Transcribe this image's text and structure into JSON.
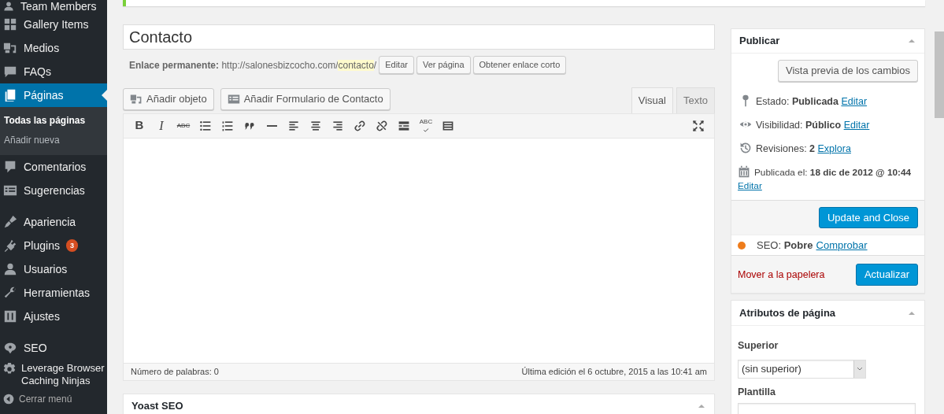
{
  "sidebar": {
    "groups": [
      [
        {
          "label": "Team Members",
          "selected": false
        },
        {
          "label": "Gallery Items",
          "selected": false
        },
        {
          "label": "Medios",
          "selected": false
        },
        {
          "label": "FAQs",
          "selected": false
        },
        {
          "label": "Páginas",
          "selected": true,
          "children": [
            {
              "label": "Todas las páginas",
              "selected": true
            },
            {
              "label": "Añadir nueva",
              "selected": false
            }
          ]
        },
        {
          "label": "Comentarios",
          "selected": false
        },
        {
          "label": "Sugerencias",
          "selected": false
        }
      ],
      [
        {
          "label": "Apariencia",
          "selected": false
        },
        {
          "label": "Plugins",
          "selected": false,
          "badge": "3"
        },
        {
          "label": "Usuarios",
          "selected": false
        },
        {
          "label": "Herramientas",
          "selected": false
        },
        {
          "label": "Ajustes",
          "selected": false
        }
      ],
      [
        {
          "label": "SEO",
          "selected": false
        },
        {
          "label": "Leverage Browser Caching Ninjas",
          "selected": false
        }
      ]
    ],
    "collapse": "Cerrar menú"
  },
  "editor": {
    "title": "Contacto",
    "permalink": {
      "label": "Enlace permanente:",
      "prefix": "http://salonesbizcocho.com/",
      "slug": "contacto",
      "suffix": "/",
      "buttons": [
        "Editar",
        "Ver página",
        "Obtener enlace corto"
      ]
    },
    "media_buttons": [
      "Añadir objeto",
      "Añadir Formulario de Contacto"
    ],
    "tabs": [
      {
        "label": "Visual",
        "selected": true
      },
      {
        "label": "Texto",
        "selected": false
      }
    ],
    "toolbar": [
      {
        "kind": "bold",
        "label": "B"
      },
      {
        "kind": "italic",
        "label": "I"
      },
      {
        "kind": "strike",
        "label": "ABC"
      },
      {
        "kind": "ul"
      },
      {
        "kind": "ol"
      },
      {
        "kind": "quote"
      },
      {
        "kind": "hr"
      },
      {
        "kind": "alignleft"
      },
      {
        "kind": "aligncenter"
      },
      {
        "kind": "alignright"
      },
      {
        "kind": "link"
      },
      {
        "kind": "unlink"
      },
      {
        "kind": "more"
      },
      {
        "kind": "spell",
        "label": "ABC"
      },
      {
        "kind": "kitchen"
      }
    ],
    "word_count": "Número de palabras: 0",
    "last_edit": "Última edición el 6 octubre, 2015 a las 10:41 am"
  },
  "yoast": {
    "title": "Yoast SEO"
  },
  "publish": {
    "title": "Publicar",
    "preview": "Vista previa de los cambios",
    "rows": [
      {
        "kind": "status",
        "label": "Estado:",
        "value": "Publicada",
        "link": "Editar"
      },
      {
        "kind": "visibility",
        "label": "Visibilidad:",
        "value": "Público",
        "link": "Editar"
      },
      {
        "kind": "revisions",
        "label": "Revisiones:",
        "value": "2",
        "link": "Explora"
      },
      {
        "kind": "date",
        "label": "Publicada el:",
        "value": "18 dic de 2012 @ 10:44",
        "link": "Editar"
      }
    ],
    "update_close": "Update and Close",
    "seo": {
      "label": "SEO:",
      "value": "Pobre",
      "link": "Comprobar",
      "color": "#ee7c1b"
    },
    "trash": "Mover a la papelera",
    "update": "Actualizar"
  },
  "attributes": {
    "title": "Atributos de página",
    "parent_label": "Superior",
    "parent_value": "(sin superior)",
    "template_label": "Plantilla"
  }
}
